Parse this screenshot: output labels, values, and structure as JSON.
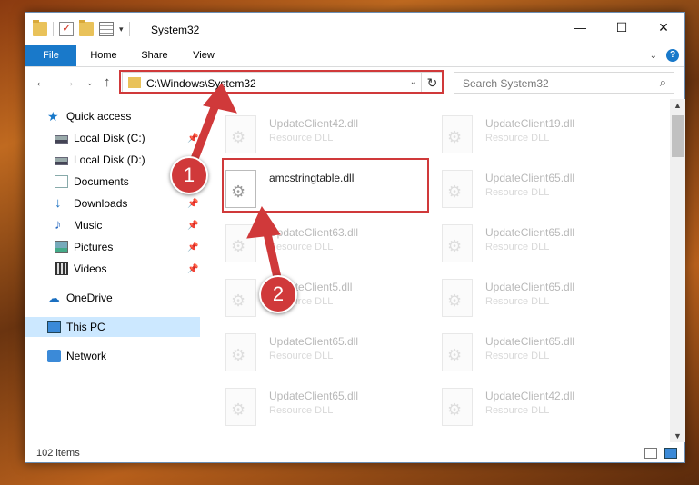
{
  "window": {
    "title": "System32",
    "controls": {
      "minimize": "—",
      "maximize": "☐",
      "close": "✕"
    }
  },
  "ribbon": {
    "tabs": [
      "File",
      "Home",
      "Share",
      "View"
    ]
  },
  "nav": {
    "address": "C:\\Windows\\System32",
    "search_placeholder": "Search System32"
  },
  "sidebar": {
    "items": [
      {
        "label": "Quick access",
        "icon": "star-icon",
        "pinned": false
      },
      {
        "label": "Local Disk (C:)",
        "icon": "disk-icon",
        "pinned": true
      },
      {
        "label": "Local Disk (D:)",
        "icon": "disk-icon",
        "pinned": false
      },
      {
        "label": "Documents",
        "icon": "documents-icon",
        "pinned": true
      },
      {
        "label": "Downloads",
        "icon": "downloads-icon",
        "pinned": true
      },
      {
        "label": "Music",
        "icon": "music-icon",
        "pinned": true
      },
      {
        "label": "Pictures",
        "icon": "pictures-icon",
        "pinned": true
      },
      {
        "label": "Videos",
        "icon": "videos-icon",
        "pinned": true
      },
      {
        "label": "OneDrive",
        "icon": "onedrive-icon",
        "pinned": false
      },
      {
        "label": "This PC",
        "icon": "this-pc-icon",
        "pinned": false,
        "selected": true
      },
      {
        "label": "Network",
        "icon": "network-icon",
        "pinned": false
      }
    ]
  },
  "files": {
    "type_label": "Resource DLL",
    "col1": [
      {
        "name": "UpdateClient42.dll"
      },
      {
        "name": "amcstringtable.dll",
        "highlighted": true
      },
      {
        "name": "UpdateClient63.dll"
      },
      {
        "name": "UpdateClient5.dll"
      },
      {
        "name": "UpdateClient65.dll"
      },
      {
        "name": "UpdateClient65.dll"
      }
    ],
    "col2": [
      {
        "name": "UpdateClient19.dll"
      },
      {
        "name": "UpdateClient65.dll"
      },
      {
        "name": "UpdateClient65.dll"
      },
      {
        "name": "UpdateClient65.dll"
      },
      {
        "name": "UpdateClient65.dll"
      },
      {
        "name": "UpdateClient42.dll"
      }
    ]
  },
  "status": {
    "item_count": "102 items"
  },
  "annotations": {
    "step1": "1",
    "step2": "2",
    "color": "#d0393a"
  }
}
